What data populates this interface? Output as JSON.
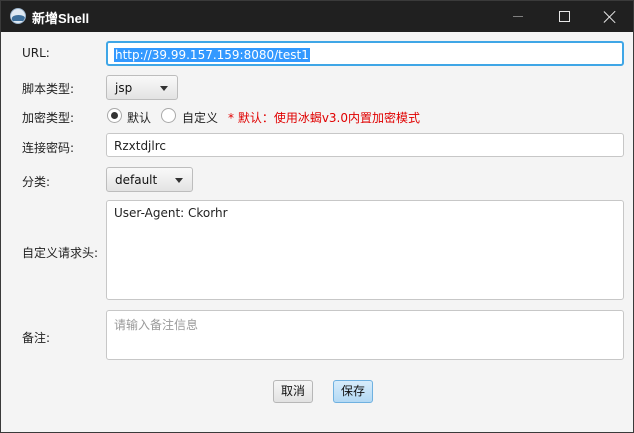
{
  "window": {
    "title": "新增Shell"
  },
  "form": {
    "url_label": "URL:",
    "url_value": "http://39.99.157.159:8080/test1",
    "script_type_label": "脚本类型:",
    "script_type_value": "jsp",
    "encryption_label": "加密类型:",
    "encryption_options": [
      "默认",
      "自定义"
    ],
    "encryption_selected": "默认",
    "encryption_hint": "* 默认：使用冰蝎v3.0内置加密模式",
    "password_label": "连接密码:",
    "password_value": "Rzxtdjlrc",
    "category_label": "分类:",
    "category_value": "default",
    "headers_label": "自定义请求头:",
    "headers_value": "User-Agent: Ckorhr",
    "notes_label": "备注:",
    "notes_placeholder": "请输入备注信息"
  },
  "buttons": {
    "cancel": "取消",
    "save": "保存"
  },
  "colors": {
    "titlebar": "#202020",
    "hint": "#e00000",
    "focus_border": "#3fa6e6",
    "selection": "#3399ff"
  }
}
